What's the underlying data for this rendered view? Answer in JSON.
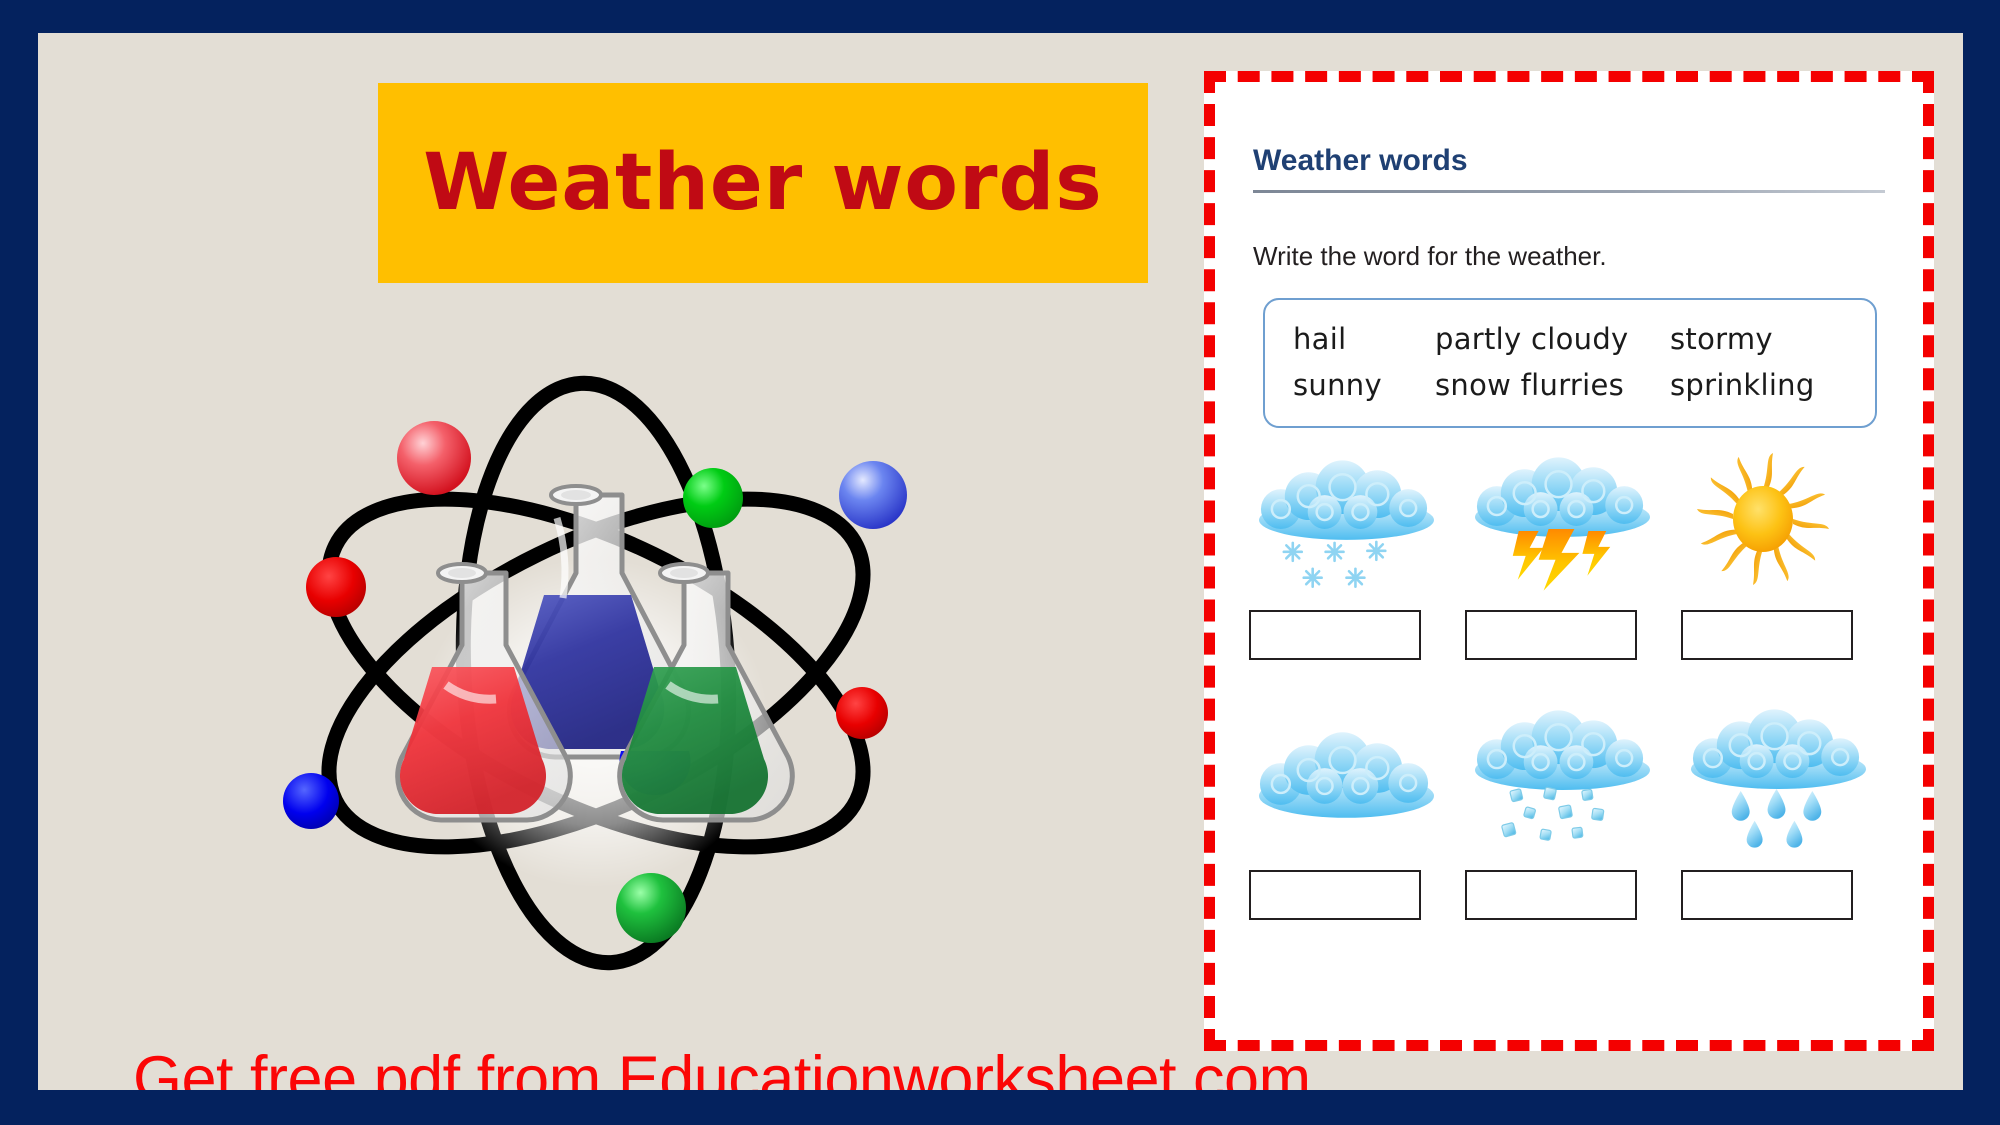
{
  "frame": {
    "border_color": "#04225e",
    "canvas_color": "#e3ded5"
  },
  "left_panel": {
    "banner": {
      "title": "Weather words",
      "background_color": "#ffbf00",
      "text_color": "#c00a14"
    },
    "graphic": {
      "name": "science-atom-flasks",
      "orbit_color": "#000000",
      "electrons": [
        {
          "color": "#f4515b",
          "label": "red-sphere-top-left"
        },
        {
          "color": "#e00000",
          "label": "red-sphere-left"
        },
        {
          "color": "#00c40c",
          "label": "green-sphere-top-mid"
        },
        {
          "color": "#4a6ff0",
          "label": "blue-sphere-top-right"
        },
        {
          "color": "#e00000",
          "label": "red-sphere-right"
        },
        {
          "color": "#0000ee",
          "label": "blue-sphere-bottom-left"
        },
        {
          "color": "#10b431",
          "label": "green-sphere-bottom"
        }
      ],
      "flasks": [
        {
          "liquid_color": "#2b2f9e",
          "label": "blue-flask"
        },
        {
          "liquid_color": "#f03038",
          "label": "red-flask"
        },
        {
          "liquid_color": "#1c8a3c",
          "label": "green-flask"
        }
      ]
    },
    "promo": {
      "text": "Get free pdf from Educationworksheet.com",
      "color": "#fb0606"
    }
  },
  "worksheet": {
    "border_color": "#f40000",
    "border_style": "dashed",
    "title": "Weather words",
    "title_color": "#1f4073",
    "instruction": "Write the word for the weather.",
    "word_bank": {
      "border_color": "#6f9fd0",
      "rows": [
        [
          "hail",
          "partly cloudy",
          "stormy"
        ],
        [
          "sunny",
          "snow flurries",
          "sprinkling"
        ]
      ]
    },
    "questions": [
      {
        "row": 1,
        "items": [
          {
            "icon": "snow-cloud-icon",
            "answer": "",
            "placeholder": ""
          },
          {
            "icon": "storm-cloud-lightning-icon",
            "answer": "",
            "placeholder": ""
          },
          {
            "icon": "sun-icon",
            "answer": "",
            "placeholder": ""
          }
        ]
      },
      {
        "row": 2,
        "items": [
          {
            "icon": "cloud-icon",
            "answer": "",
            "placeholder": ""
          },
          {
            "icon": "hail-cloud-icon",
            "answer": "",
            "placeholder": ""
          },
          {
            "icon": "rain-cloud-icon",
            "answer": "",
            "placeholder": ""
          }
        ]
      }
    ]
  }
}
